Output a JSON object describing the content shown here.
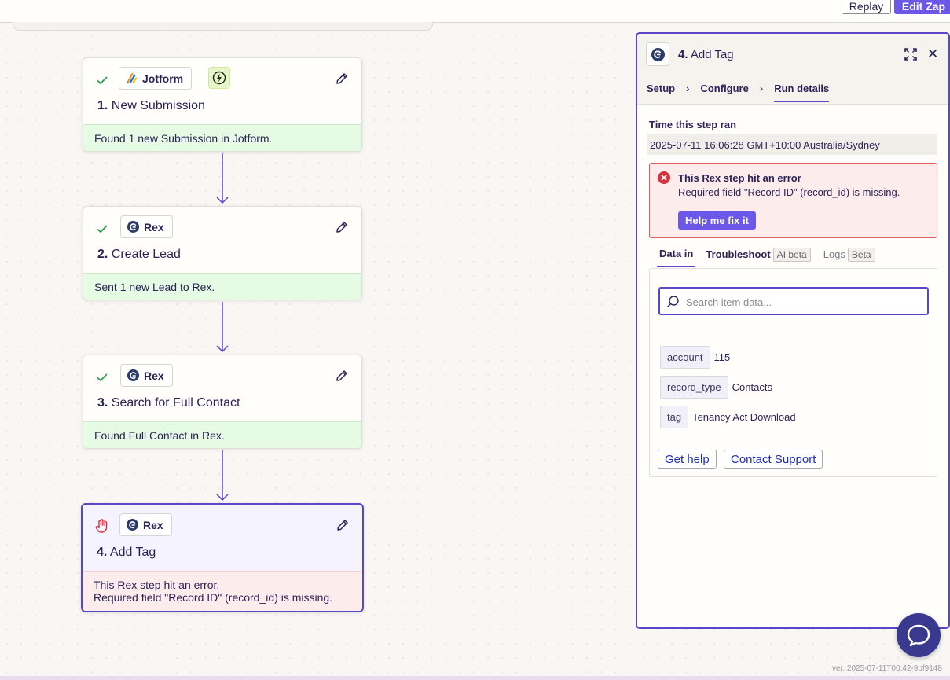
{
  "topbar": {
    "replay_label": "Replay",
    "edit_zap_label": "Edit Zap"
  },
  "steps": [
    {
      "number": "1.",
      "title": "New Submission",
      "app": "Jotform",
      "status": "success",
      "message": "Found 1 new Submission in Jotform."
    },
    {
      "number": "2.",
      "title": "Create Lead",
      "app": "Rex",
      "status": "success",
      "message": "Sent 1 new Lead to Rex."
    },
    {
      "number": "3.",
      "title": "Search for Full Contact",
      "app": "Rex",
      "status": "success",
      "message": "Found Full Contact in Rex."
    },
    {
      "number": "4.",
      "title": "Add Tag",
      "app": "Rex",
      "status": "error",
      "message_line1": "This Rex step hit an error.",
      "message_line2": "Required field \"Record ID\" (record_id) is missing."
    }
  ],
  "panel": {
    "step_number": "4.",
    "step_title": "Add Tag",
    "tabs": [
      "Setup",
      "Configure",
      "Run details"
    ],
    "active_tab": "Run details",
    "time_label": "Time this step ran",
    "time_value": "2025-07-11 16:06:28 GMT+10:00 Australia/Sydney",
    "error": {
      "title": "This Rex step hit an error",
      "message": "Required field \"Record ID\" (record_id) is missing.",
      "fix_button": "Help me fix it"
    },
    "subtabs": {
      "data_in": "Data in",
      "troubleshoot": "Troubleshoot",
      "troubleshoot_badge": "AI beta",
      "logs": "Logs",
      "logs_badge": "Beta"
    },
    "search_placeholder": "Search item data...",
    "fields": [
      {
        "key": "account",
        "value": "115"
      },
      {
        "key": "record_type",
        "value": "Contacts"
      },
      {
        "key": "tag",
        "value": "Tenancy Act Download"
      }
    ],
    "get_help_label": "Get help",
    "contact_support_label": "Contact Support"
  },
  "version": "ver. 2025-07-11T00:42-9bf9148",
  "colors": {
    "accent": "#5a46c8",
    "success_bg": "#e6fbe4",
    "error_bg": "#fdecec",
    "error_red": "#d8323c"
  }
}
